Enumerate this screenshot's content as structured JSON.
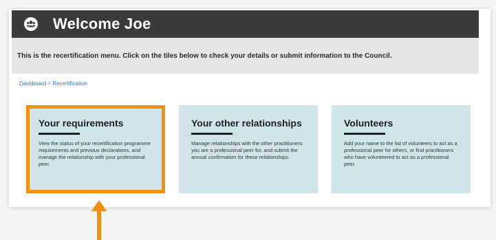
{
  "header": {
    "icon": "users-icon",
    "title": "Welcome Joe"
  },
  "banner": {
    "text": "This is the recertification menu. Click on the tiles below to check your details or submit information to the Council."
  },
  "breadcrumb": {
    "items": [
      "Dashboard",
      "Recertification"
    ],
    "separator": ">"
  },
  "tiles": [
    {
      "title": "Your requirements",
      "description": "View the status of your recertification programme requirements and previous declarations, and manage the relationship with your professional peer.",
      "selected": true
    },
    {
      "title": "Your other relationships",
      "description": "Manage relationships with the other practitioners you are a professional peer for, and submit the annual confirmation for these relationships.",
      "selected": false
    },
    {
      "title": "Volunteers",
      "description": "Add your name to the list of volunteers to act as a professional peer for others, or find practitioners who have volunteered to act as a professional peer.",
      "selected": false
    }
  ],
  "colors": {
    "header_bg": "#3a3a3a",
    "tile_bg": "#cfe5ea",
    "highlight": "#f2900f",
    "link": "#2a73b8"
  },
  "annotation": {
    "icon": "up-arrow-icon"
  }
}
